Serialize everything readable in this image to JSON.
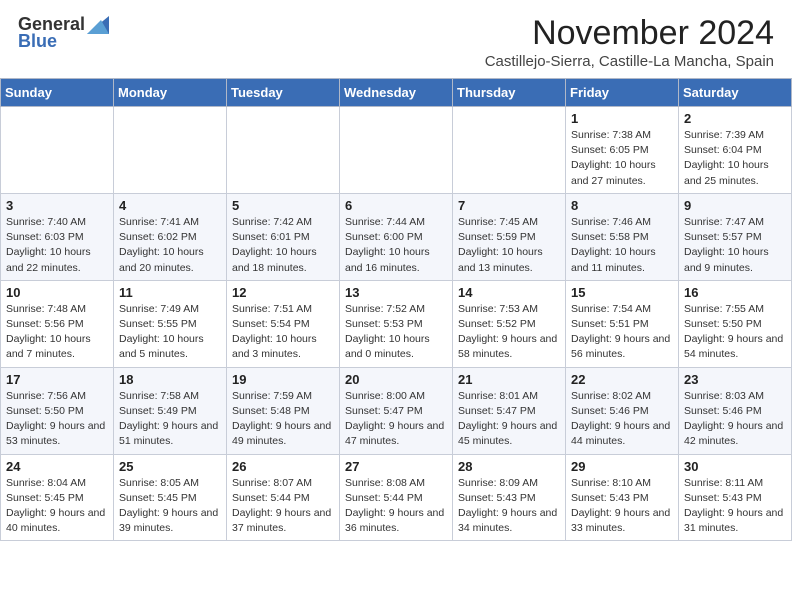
{
  "header": {
    "logo_general": "General",
    "logo_blue": "Blue",
    "month_title": "November 2024",
    "location": "Castillejo-Sierra, Castille-La Mancha, Spain"
  },
  "calendar": {
    "weekdays": [
      "Sunday",
      "Monday",
      "Tuesday",
      "Wednesday",
      "Thursday",
      "Friday",
      "Saturday"
    ],
    "weeks": [
      [
        {
          "day": "",
          "info": ""
        },
        {
          "day": "",
          "info": ""
        },
        {
          "day": "",
          "info": ""
        },
        {
          "day": "",
          "info": ""
        },
        {
          "day": "",
          "info": ""
        },
        {
          "day": "1",
          "info": "Sunrise: 7:38 AM\nSunset: 6:05 PM\nDaylight: 10 hours and 27 minutes."
        },
        {
          "day": "2",
          "info": "Sunrise: 7:39 AM\nSunset: 6:04 PM\nDaylight: 10 hours and 25 minutes."
        }
      ],
      [
        {
          "day": "3",
          "info": "Sunrise: 7:40 AM\nSunset: 6:03 PM\nDaylight: 10 hours and 22 minutes."
        },
        {
          "day": "4",
          "info": "Sunrise: 7:41 AM\nSunset: 6:02 PM\nDaylight: 10 hours and 20 minutes."
        },
        {
          "day": "5",
          "info": "Sunrise: 7:42 AM\nSunset: 6:01 PM\nDaylight: 10 hours and 18 minutes."
        },
        {
          "day": "6",
          "info": "Sunrise: 7:44 AM\nSunset: 6:00 PM\nDaylight: 10 hours and 16 minutes."
        },
        {
          "day": "7",
          "info": "Sunrise: 7:45 AM\nSunset: 5:59 PM\nDaylight: 10 hours and 13 minutes."
        },
        {
          "day": "8",
          "info": "Sunrise: 7:46 AM\nSunset: 5:58 PM\nDaylight: 10 hours and 11 minutes."
        },
        {
          "day": "9",
          "info": "Sunrise: 7:47 AM\nSunset: 5:57 PM\nDaylight: 10 hours and 9 minutes."
        }
      ],
      [
        {
          "day": "10",
          "info": "Sunrise: 7:48 AM\nSunset: 5:56 PM\nDaylight: 10 hours and 7 minutes."
        },
        {
          "day": "11",
          "info": "Sunrise: 7:49 AM\nSunset: 5:55 PM\nDaylight: 10 hours and 5 minutes."
        },
        {
          "day": "12",
          "info": "Sunrise: 7:51 AM\nSunset: 5:54 PM\nDaylight: 10 hours and 3 minutes."
        },
        {
          "day": "13",
          "info": "Sunrise: 7:52 AM\nSunset: 5:53 PM\nDaylight: 10 hours and 0 minutes."
        },
        {
          "day": "14",
          "info": "Sunrise: 7:53 AM\nSunset: 5:52 PM\nDaylight: 9 hours and 58 minutes."
        },
        {
          "day": "15",
          "info": "Sunrise: 7:54 AM\nSunset: 5:51 PM\nDaylight: 9 hours and 56 minutes."
        },
        {
          "day": "16",
          "info": "Sunrise: 7:55 AM\nSunset: 5:50 PM\nDaylight: 9 hours and 54 minutes."
        }
      ],
      [
        {
          "day": "17",
          "info": "Sunrise: 7:56 AM\nSunset: 5:50 PM\nDaylight: 9 hours and 53 minutes."
        },
        {
          "day": "18",
          "info": "Sunrise: 7:58 AM\nSunset: 5:49 PM\nDaylight: 9 hours and 51 minutes."
        },
        {
          "day": "19",
          "info": "Sunrise: 7:59 AM\nSunset: 5:48 PM\nDaylight: 9 hours and 49 minutes."
        },
        {
          "day": "20",
          "info": "Sunrise: 8:00 AM\nSunset: 5:47 PM\nDaylight: 9 hours and 47 minutes."
        },
        {
          "day": "21",
          "info": "Sunrise: 8:01 AM\nSunset: 5:47 PM\nDaylight: 9 hours and 45 minutes."
        },
        {
          "day": "22",
          "info": "Sunrise: 8:02 AM\nSunset: 5:46 PM\nDaylight: 9 hours and 44 minutes."
        },
        {
          "day": "23",
          "info": "Sunrise: 8:03 AM\nSunset: 5:46 PM\nDaylight: 9 hours and 42 minutes."
        }
      ],
      [
        {
          "day": "24",
          "info": "Sunrise: 8:04 AM\nSunset: 5:45 PM\nDaylight: 9 hours and 40 minutes."
        },
        {
          "day": "25",
          "info": "Sunrise: 8:05 AM\nSunset: 5:45 PM\nDaylight: 9 hours and 39 minutes."
        },
        {
          "day": "26",
          "info": "Sunrise: 8:07 AM\nSunset: 5:44 PM\nDaylight: 9 hours and 37 minutes."
        },
        {
          "day": "27",
          "info": "Sunrise: 8:08 AM\nSunset: 5:44 PM\nDaylight: 9 hours and 36 minutes."
        },
        {
          "day": "28",
          "info": "Sunrise: 8:09 AM\nSunset: 5:43 PM\nDaylight: 9 hours and 34 minutes."
        },
        {
          "day": "29",
          "info": "Sunrise: 8:10 AM\nSunset: 5:43 PM\nDaylight: 9 hours and 33 minutes."
        },
        {
          "day": "30",
          "info": "Sunrise: 8:11 AM\nSunset: 5:43 PM\nDaylight: 9 hours and 31 minutes."
        }
      ]
    ]
  }
}
